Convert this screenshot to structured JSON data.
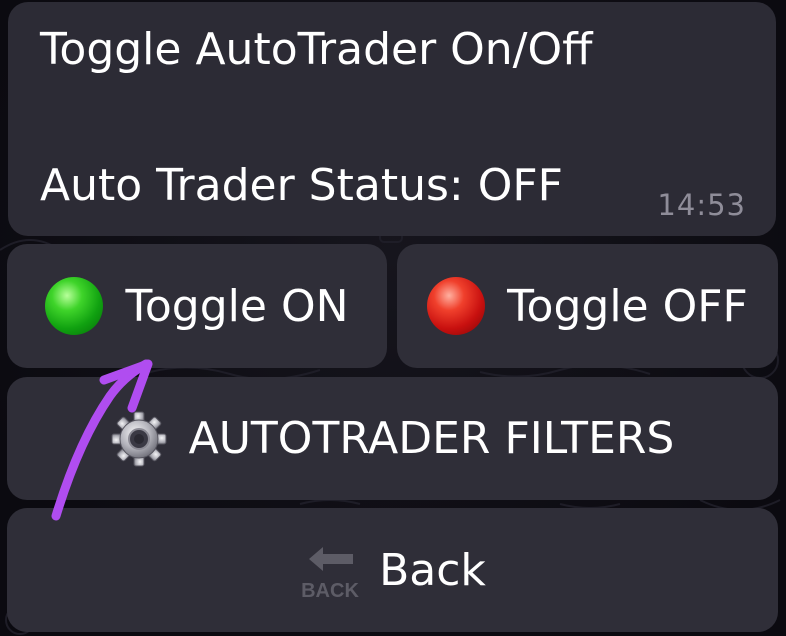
{
  "message": {
    "title": "Toggle AutoTrader On/Off",
    "status": "Auto Trader Status: OFF",
    "time": "14:53"
  },
  "keyboard": {
    "toggle_on": {
      "label": "Toggle ON",
      "icon": "green-circle-icon"
    },
    "toggle_off": {
      "label": "Toggle OFF",
      "icon": "red-circle-icon"
    },
    "filters": {
      "label": "AUTOTRADER FILTERS",
      "icon": "gear-icon"
    },
    "back": {
      "label": "Back",
      "icon": "back-arrow-icon",
      "icon_text": "BACK"
    }
  },
  "annotation": {
    "icon": "purple-arrow-icon",
    "color": "#b04df0"
  },
  "colors": {
    "bubble": "#2c2b35",
    "button": "#2f2e38",
    "text": "#ffffff",
    "time": "#8f8d99"
  }
}
